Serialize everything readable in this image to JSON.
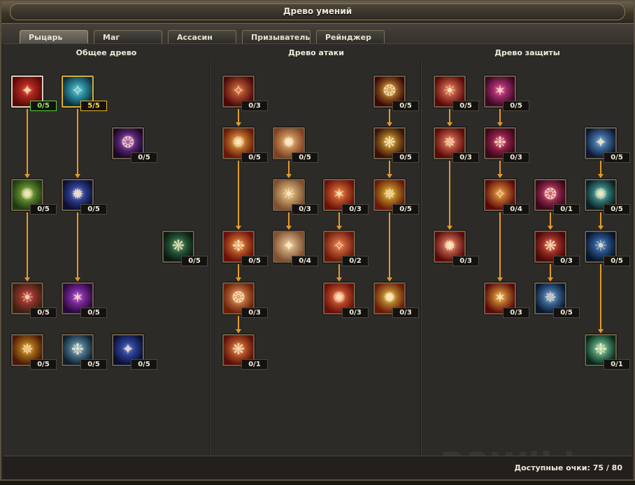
{
  "window": {
    "title": "Древо умений"
  },
  "tabs": [
    {
      "label": "Рыцарь",
      "active": true
    },
    {
      "label": "Маг",
      "active": false
    },
    {
      "label": "Ассасин",
      "active": false
    },
    {
      "label": "Призыватель",
      "active": false
    },
    {
      "label": "Рейнджер",
      "active": false
    }
  ],
  "columns": {
    "general": "Общее древо",
    "attack": "Древо атаки",
    "defense": "Древо защиты"
  },
  "skills": [
    {
      "id": "g1",
      "icon": "demon-red-icon",
      "level": "0/5",
      "badge": "green",
      "frame": "white",
      "colors": [
        "#e03a2a",
        "#5a0808"
      ]
    },
    {
      "id": "g2",
      "icon": "spirit-cyan-icon",
      "level": "5/5",
      "badge": "gold",
      "frame": "gold",
      "colors": [
        "#4ad0e8",
        "#0a3040"
      ]
    },
    {
      "id": "g3",
      "icon": "shadow-purple-icon",
      "level": "0/5",
      "colors": [
        "#9a40c8",
        "#1a0828"
      ]
    },
    {
      "id": "g4",
      "icon": "holy-cross-icon",
      "level": "0/5",
      "colors": [
        "#8ac040",
        "#1e3a10"
      ]
    },
    {
      "id": "g5",
      "icon": "blue-orbs-icon",
      "level": "0/5",
      "colors": [
        "#4a60e0",
        "#0a1030"
      ]
    },
    {
      "id": "g6",
      "icon": "green-beast-icon",
      "level": "0/5",
      "colors": [
        "#3a8a5a",
        "#0a1a10"
      ]
    },
    {
      "id": "g7",
      "icon": "red-cross-icon",
      "level": "0/5",
      "colors": [
        "#d04040",
        "#3a2010"
      ]
    },
    {
      "id": "g8",
      "icon": "purple-orb-icon",
      "level": "0/5",
      "colors": [
        "#b040e0",
        "#280838"
      ]
    },
    {
      "id": "g9",
      "icon": "golden-skull-icon",
      "level": "0/5",
      "colors": [
        "#e0a020",
        "#4a1808"
      ]
    },
    {
      "id": "g10",
      "icon": "cyan-tree-icon",
      "level": "0/5",
      "colors": [
        "#70b0d0",
        "#102030"
      ]
    },
    {
      "id": "g11",
      "icon": "blue-hands-icon",
      "level": "0/5",
      "colors": [
        "#4060d8",
        "#0a1030"
      ]
    },
    {
      "id": "a1",
      "icon": "red-aura-icon",
      "level": "0/3",
      "colors": [
        "#e07040",
        "#4a0808"
      ]
    },
    {
      "id": "a2",
      "icon": "flaming-sword-icon",
      "level": "0/5",
      "colors": [
        "#e0a030",
        "#3a0808"
      ]
    },
    {
      "id": "a3",
      "icon": "fire-sword-icon",
      "level": "0/5",
      "colors": [
        "#f0b040",
        "#6a1808"
      ]
    },
    {
      "id": "a4",
      "icon": "light-rays-icon",
      "level": "0/5",
      "colors": [
        "#f0c080",
        "#804020"
      ]
    },
    {
      "id": "a5",
      "icon": "blade-strike-icon",
      "level": "0/5",
      "colors": [
        "#e0b030",
        "#3a1008"
      ]
    },
    {
      "id": "a6",
      "icon": "light-pillars-icon",
      "level": "0/3",
      "colors": [
        "#f0d090",
        "#805030"
      ]
    },
    {
      "id": "a7",
      "icon": "fire-star-icon",
      "level": "0/3",
      "colors": [
        "#f08040",
        "#6a1008"
      ]
    },
    {
      "id": "a8",
      "icon": "golden-mace-icon",
      "level": "0/5",
      "colors": [
        "#e0c030",
        "#6a1808"
      ]
    },
    {
      "id": "a9",
      "icon": "fire-burst-icon",
      "level": "0/5",
      "colors": [
        "#f09040",
        "#6a1008"
      ]
    },
    {
      "id": "a10",
      "icon": "light-wall-icon",
      "level": "0/4",
      "colors": [
        "#f0d0a0",
        "#805030"
      ]
    },
    {
      "id": "a11",
      "icon": "sun-star-icon",
      "level": "0/2",
      "colors": [
        "#f08050",
        "#6a1808"
      ]
    },
    {
      "id": "a12",
      "icon": "ember-ring-icon",
      "level": "0/3",
      "colors": [
        "#f0a060",
        "#6a2008"
      ]
    },
    {
      "id": "a13",
      "icon": "crimson-star-icon",
      "level": "0/3",
      "colors": [
        "#f07040",
        "#6a1008"
      ]
    },
    {
      "id": "a14",
      "icon": "golden-hammer-icon",
      "level": "0/3",
      "colors": [
        "#e0c040",
        "#6a1808"
      ]
    },
    {
      "id": "a15",
      "icon": "fire-spark-icon",
      "level": "0/1",
      "colors": [
        "#f08040",
        "#5a1008"
      ]
    },
    {
      "id": "d1",
      "icon": "crest-aura-icon",
      "level": "0/5",
      "colors": [
        "#f08060",
        "#5a0808"
      ]
    },
    {
      "id": "d2",
      "icon": "pink-glow-icon",
      "level": "0/5",
      "colors": [
        "#e040a0",
        "#3a0820"
      ]
    },
    {
      "id": "d3",
      "icon": "crest-shield-icon",
      "level": "0/3",
      "colors": [
        "#f08060",
        "#5a0808"
      ]
    },
    {
      "id": "d4",
      "icon": "crimson-vortex-icon",
      "level": "0/3",
      "colors": [
        "#d03070",
        "#3a0818"
      ]
    },
    {
      "id": "d5",
      "icon": "frost-tree-icon",
      "level": "0/5",
      "colors": [
        "#60a0e0",
        "#0a1830"
      ]
    },
    {
      "id": "d6",
      "icon": "sun-crest-icon",
      "level": "0/4",
      "colors": [
        "#f0a040",
        "#5a0808"
      ]
    },
    {
      "id": "d7",
      "icon": "blood-splat-icon",
      "level": "0/1",
      "colors": [
        "#e04080",
        "#3a0818"
      ]
    },
    {
      "id": "d8",
      "icon": "ice-tree-icon",
      "level": "0/5",
      "colors": [
        "#50c0c0",
        "#0a2020"
      ]
    },
    {
      "id": "d9",
      "icon": "crest-emblem-icon",
      "level": "0/3",
      "colors": [
        "#f09070",
        "#5a0808"
      ]
    },
    {
      "id": "d10",
      "icon": "red-shatter-icon",
      "level": "0/3",
      "colors": [
        "#e05040",
        "#4a0808"
      ]
    },
    {
      "id": "d11",
      "icon": "lightning-tree-icon",
      "level": "0/5",
      "colors": [
        "#4080d0",
        "#081428"
      ]
    },
    {
      "id": "d12",
      "icon": "golden-crest-icon",
      "level": "0/3",
      "colors": [
        "#f0b040",
        "#5a0808"
      ]
    },
    {
      "id": "d13",
      "icon": "frost-shatter-icon",
      "level": "0/5",
      "colors": [
        "#60a0e0",
        "#0a1830"
      ]
    },
    {
      "id": "d14",
      "icon": "green-light-icon",
      "level": "0/1",
      "colors": [
        "#80e0b0",
        "#0a2818"
      ]
    }
  ],
  "footer": {
    "points_label": "Доступные очки: 75 / 80"
  },
  "watermark": "R2Wiki.ru"
}
